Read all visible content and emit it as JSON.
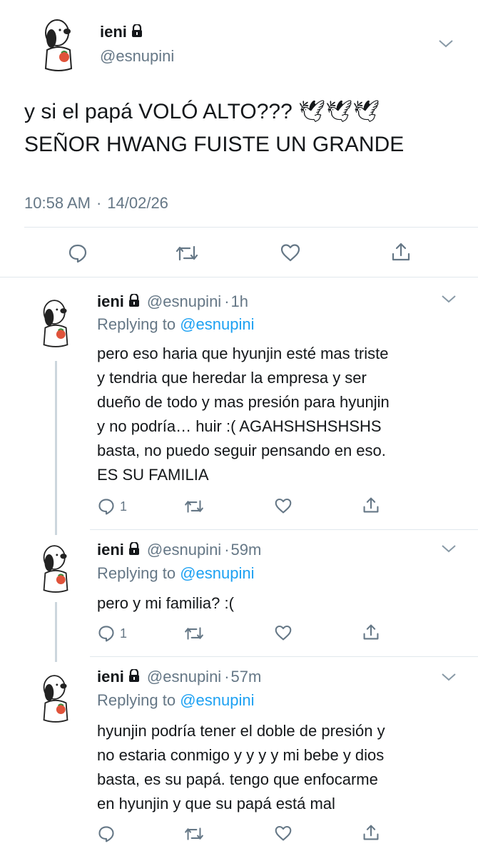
{
  "main": {
    "name": "ieni",
    "handle": "@esnupini",
    "text": "y si el papá VOLÓ ALTO??? 🕊🕊🕊\nSEÑOR HWANG FUISTE UN GRANDE",
    "time": "10:58 AM",
    "sep": "·",
    "date": "14/02/26"
  },
  "replies": [
    {
      "name": "ieni",
      "handle": "@esnupini",
      "sep": "·",
      "time": "1h",
      "replying_prefix": "Replying to",
      "replying_to": "@esnupini",
      "text": "pero eso haria que hyunjin esté mas triste\ny tendria que heredar la empresa y ser\ndueño de todo y mas presión para hyunjin\ny no podría… huir :( AGAHSHSHSHSHS\nbasta, no puedo seguir pensando en eso.\nES SU FAMILIA",
      "reply_count": "1"
    },
    {
      "name": "ieni",
      "handle": "@esnupini",
      "sep": "·",
      "time": "59m",
      "replying_prefix": "Replying to",
      "replying_to": "@esnupini",
      "text": "pero y mi familia? :(",
      "reply_count": "1"
    },
    {
      "name": "ieni",
      "handle": "@esnupini",
      "sep": "·",
      "time": "57m",
      "replying_prefix": "Replying to",
      "replying_to": "@esnupini",
      "text": "hyunjin podría tener el doble de presión y\nno estaria conmigo y y y y mi bebe y dios\nbasta, es su papá. tengo que enfocarme\nen hyunjin y que su papá está mal",
      "reply_count": ""
    }
  ],
  "icons": {
    "lock": "lock-icon",
    "chevron": "chevron-down-icon",
    "reply": "reply-icon",
    "retweet": "retweet-icon",
    "like": "heart-icon",
    "share": "share-icon",
    "dove": "dove-emoji"
  },
  "colors": {
    "text": "#14171a",
    "secondary": "#657786",
    "accent": "#1da1f2",
    "divider": "#e1e8ed",
    "thread": "#ccd6dd"
  }
}
